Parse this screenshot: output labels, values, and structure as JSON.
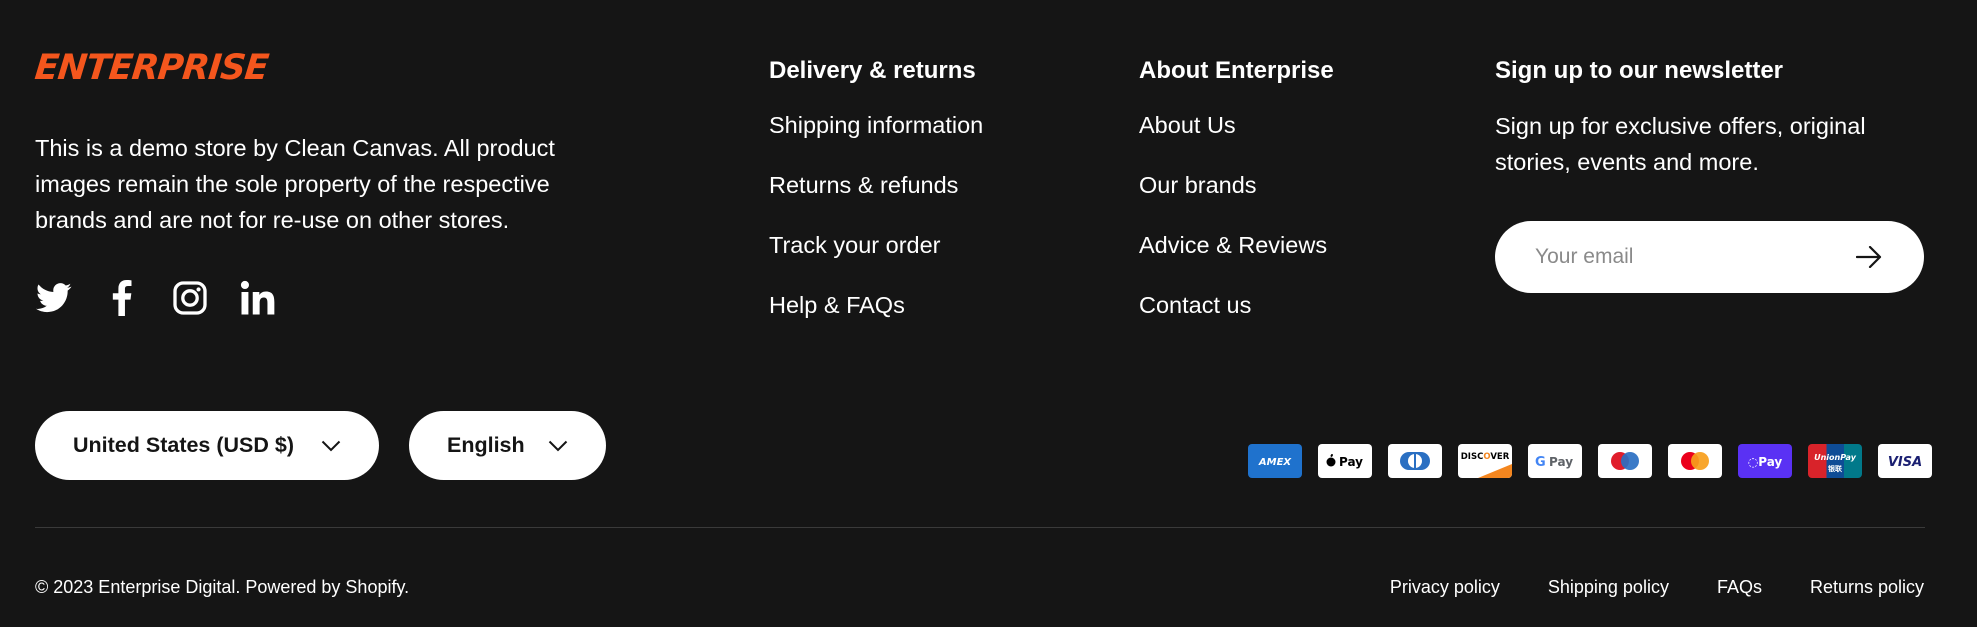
{
  "brand": {
    "name": "ENTERPRISE",
    "accent_color": "#F4561D",
    "description": "This is a demo store by Clean Canvas. All product images remain the sole property of the respective brands and are not for re-use on other stores."
  },
  "social": [
    "twitter-icon",
    "facebook-icon",
    "instagram-icon",
    "linkedin-icon"
  ],
  "columns": {
    "delivery": {
      "heading": "Delivery & returns",
      "links": [
        "Shipping information",
        "Returns & refunds",
        "Track your order",
        "Help & FAQs"
      ]
    },
    "about": {
      "heading": "About Enterprise",
      "links": [
        "About Us",
        "Our brands",
        "Advice & Reviews",
        "Contact us"
      ]
    }
  },
  "newsletter": {
    "heading": "Sign up to our newsletter",
    "text": "Sign up for exclusive offers, original stories, events and more.",
    "placeholder": "Your email",
    "submit_icon": "arrow-right-icon"
  },
  "selectors": {
    "country": "United States (USD $)",
    "language": "English"
  },
  "payments": [
    "American Express",
    "Apple Pay",
    "Diners Club",
    "Discover",
    "Google Pay",
    "Maestro",
    "Mastercard",
    "Shop Pay",
    "UnionPay",
    "Visa"
  ],
  "footer": {
    "copyright": "© 2023 Enterprise Digital. Powered by Shopify.",
    "policies": [
      "Privacy policy",
      "Shipping policy",
      "FAQs",
      "Returns policy"
    ]
  }
}
